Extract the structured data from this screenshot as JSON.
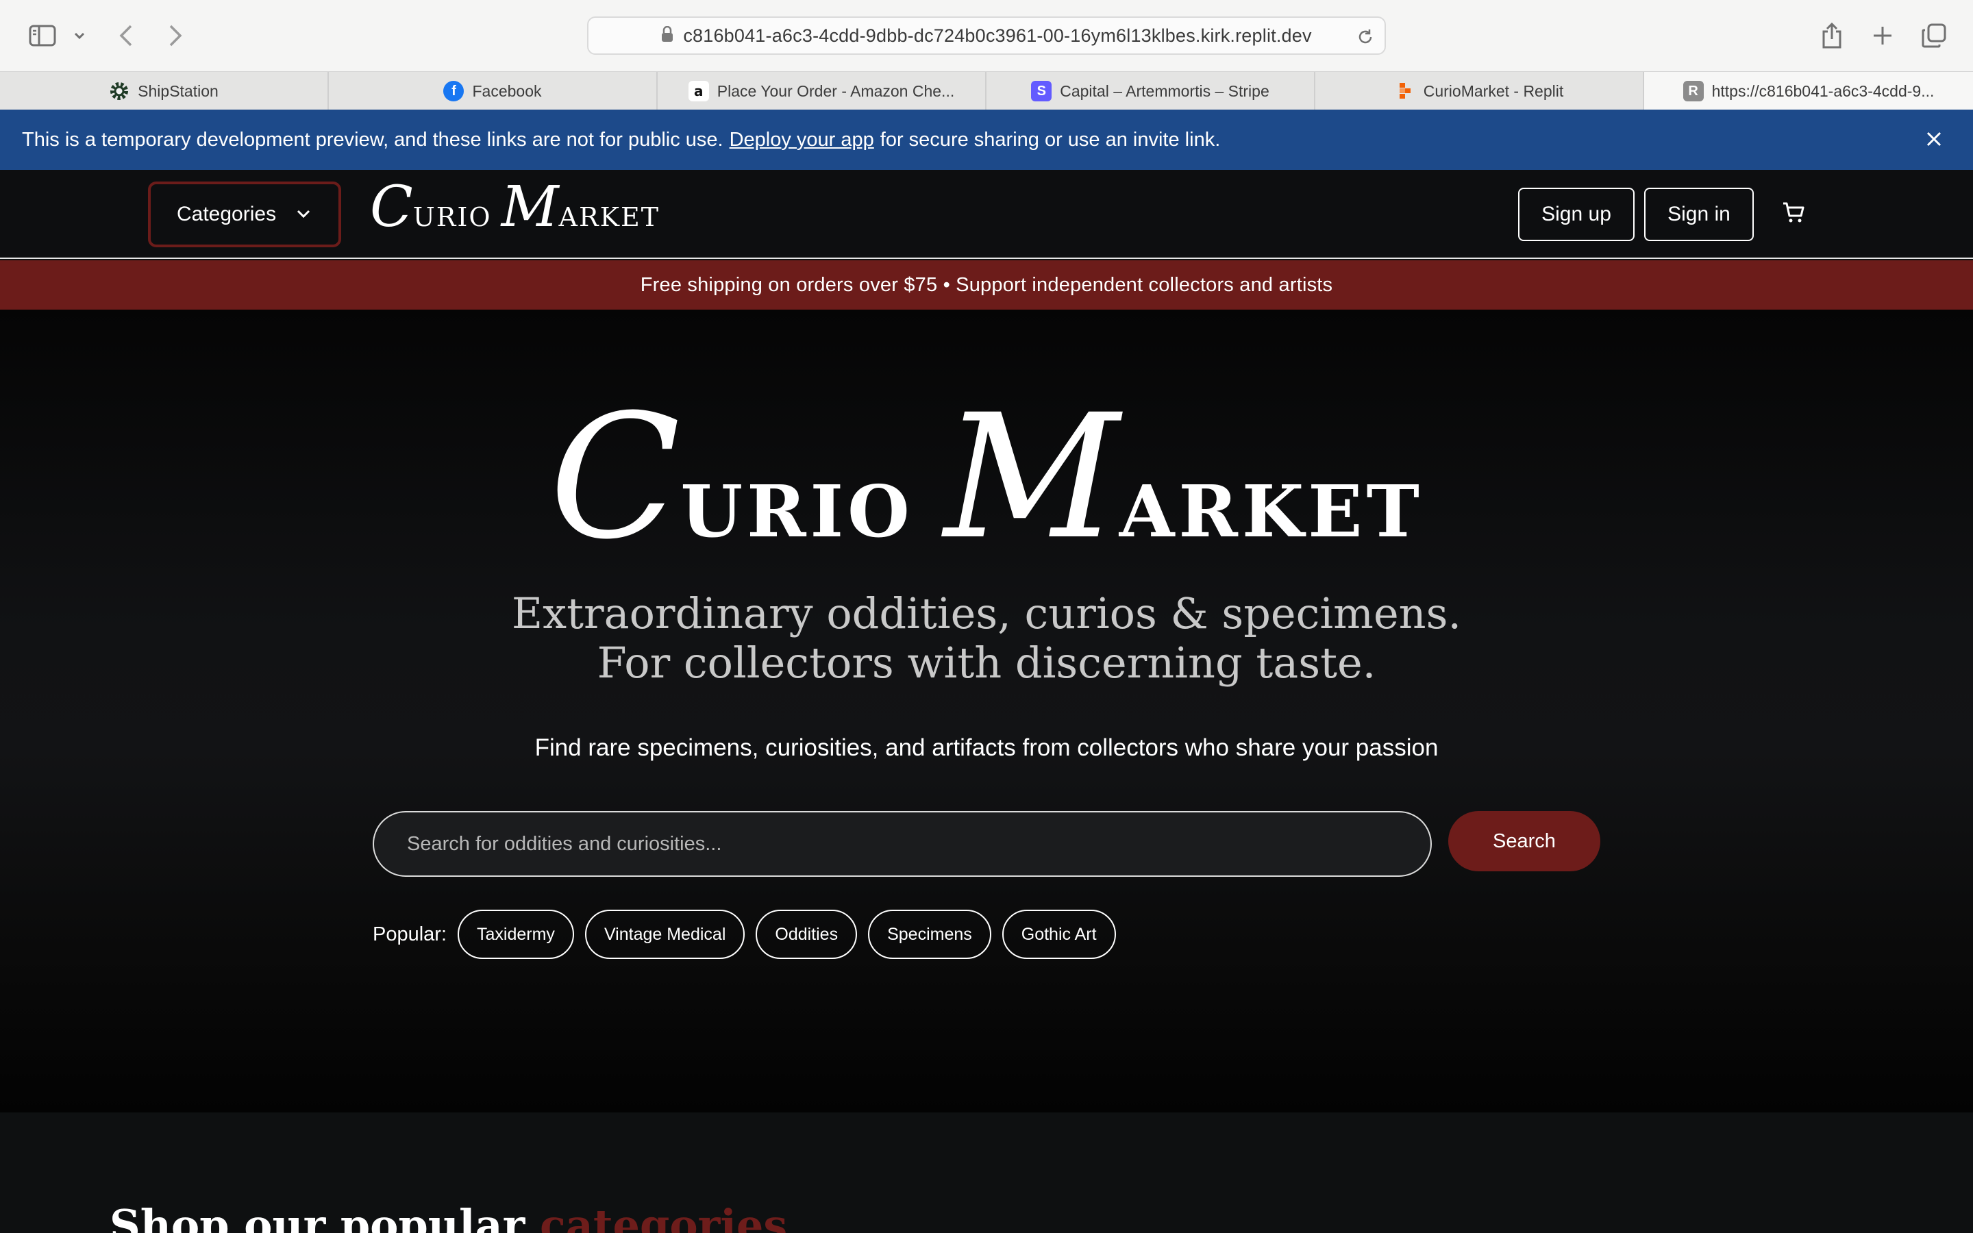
{
  "browser": {
    "url": "c816b041-a6c3-4cdd-9dbb-dc724b0c3961-00-16ym6l13klbes.kirk.replit.dev",
    "tabs": [
      {
        "label": "ShipStation",
        "icon": "shipstation-icon"
      },
      {
        "label": "Facebook",
        "icon": "facebook-icon"
      },
      {
        "label": "Place Your Order - Amazon Che...",
        "icon": "amazon-icon"
      },
      {
        "label": "Capital – Artemmortis – Stripe",
        "icon": "stripe-icon"
      },
      {
        "label": "CurioMarket - Replit",
        "icon": "replit-icon"
      },
      {
        "label": "https://c816b041-a6c3-4cdd-9...",
        "icon": "r-icon",
        "active": true
      }
    ]
  },
  "dev_banner": {
    "text_before": "This is a temporary development preview, and these links are not for public use.",
    "link": "Deploy your app",
    "text_after": "for secure sharing or use an invite link."
  },
  "header": {
    "categories_label": "Categories",
    "logo": {
      "c": "C",
      "urio": "URIO",
      "m": "M",
      "arket": "ARKET"
    },
    "signup_label": "Sign up",
    "signin_label": "Sign in"
  },
  "promo": "Free shipping on orders over $75 • Support independent collectors and artists",
  "hero": {
    "logo": {
      "c": "C",
      "urio": "URIO",
      "m": "M",
      "arket": "ARKET"
    },
    "tagline_1": "Extraordinary oddities, curios & specimens.",
    "tagline_2": "For collectors with discerning taste.",
    "subline": "Find rare specimens, curiosities, and artifacts from collectors who share your passion",
    "search_placeholder": "Search for oddities and curiosities...",
    "search_button": "Search",
    "popular_label": "Popular:",
    "popular": [
      "Taxidermy",
      "Vintage Medical",
      "Oddities",
      "Specimens",
      "Gothic Art"
    ]
  },
  "section2": {
    "title_start": "Shop our popular",
    "title_accent": "categories"
  },
  "colors": {
    "banner_blue": "#1d4a8a",
    "brand_red": "#6c1c1a",
    "header_bg": "#0d0e10"
  }
}
